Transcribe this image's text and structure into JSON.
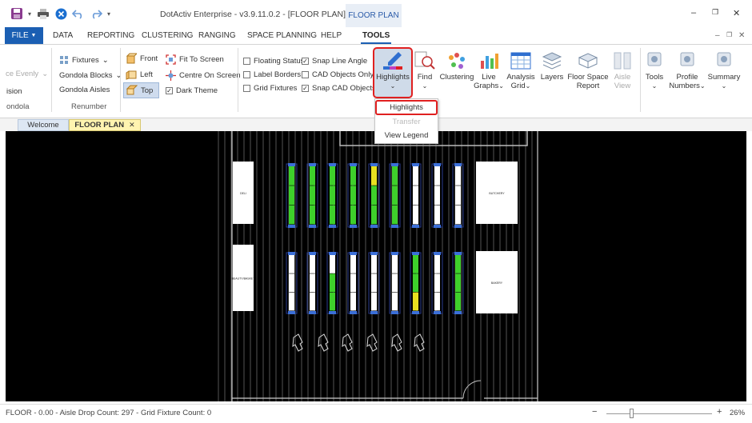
{
  "title": "DotActiv Enterprise - v3.9.11.0.2 - [FLOOR PLAN]",
  "context_tab": "FLOOR PLAN",
  "menu": {
    "file": "FILE",
    "tabs": [
      "DATA",
      "REPORTING",
      "CLUSTERING",
      "RANGING",
      "SPACE PLANNING",
      "HELP",
      "TOOLS"
    ],
    "active": "TOOLS"
  },
  "ribbon": {
    "left_partial": [
      "ce Evenly",
      "ision",
      "ondola"
    ],
    "fixtures": "Fixtures",
    "gondola_blocks": "Gondola Blocks",
    "gondola_aisles": "Gondola Aisles",
    "renumber": "Renumber",
    "views": {
      "front": "Front",
      "left": "Left",
      "top": "Top"
    },
    "fit_to_screen": "Fit To Screen",
    "centre_on_screen": "Centre On Screen",
    "dark_theme": "Dark Theme",
    "checks": {
      "floating_status": "Floating Status",
      "label_borders": "Label Borders",
      "grid_fixtures": "Grid Fixtures",
      "snap_line_angle": "Snap Line Angle",
      "cad_objects_only": "CAD Objects Only",
      "snap_cad_objects": "Snap CAD Objects"
    },
    "buttons": {
      "highlights": "Highlights",
      "find": "Find",
      "clustering": "Clustering",
      "live": "Live",
      "graphs": "Graphs",
      "analysis": "Analysis",
      "grid": "Grid",
      "layers": "Layers",
      "floor_space": "Floor Space",
      "report": "Report",
      "aisle": "Aisle",
      "view": "View",
      "tools": "Tools",
      "profile": "Profile",
      "numbers": "Numbers",
      "summary": "Summary"
    }
  },
  "dropdown": [
    "Highlights",
    "Transfer",
    "View Legend"
  ],
  "doc_tabs": {
    "welcome": "Welcome",
    "floor_plan": "FLOOR PLAN"
  },
  "floor": {
    "labels": [
      "BUTCHERY",
      "BAKERY",
      "DELI",
      "BEAUTY/BASKET"
    ]
  },
  "status": {
    "left": "FLOOR - 0.00 - Aisle Drop Count: 297 - Grid Fixture Count: 0",
    "zoom": "26%",
    "minus": "−",
    "plus": "+"
  },
  "colors": {
    "accent": "#1b5fb3",
    "highlight_red": "#e02020",
    "green": "#3ed02b",
    "yellow": "#e8e020"
  }
}
